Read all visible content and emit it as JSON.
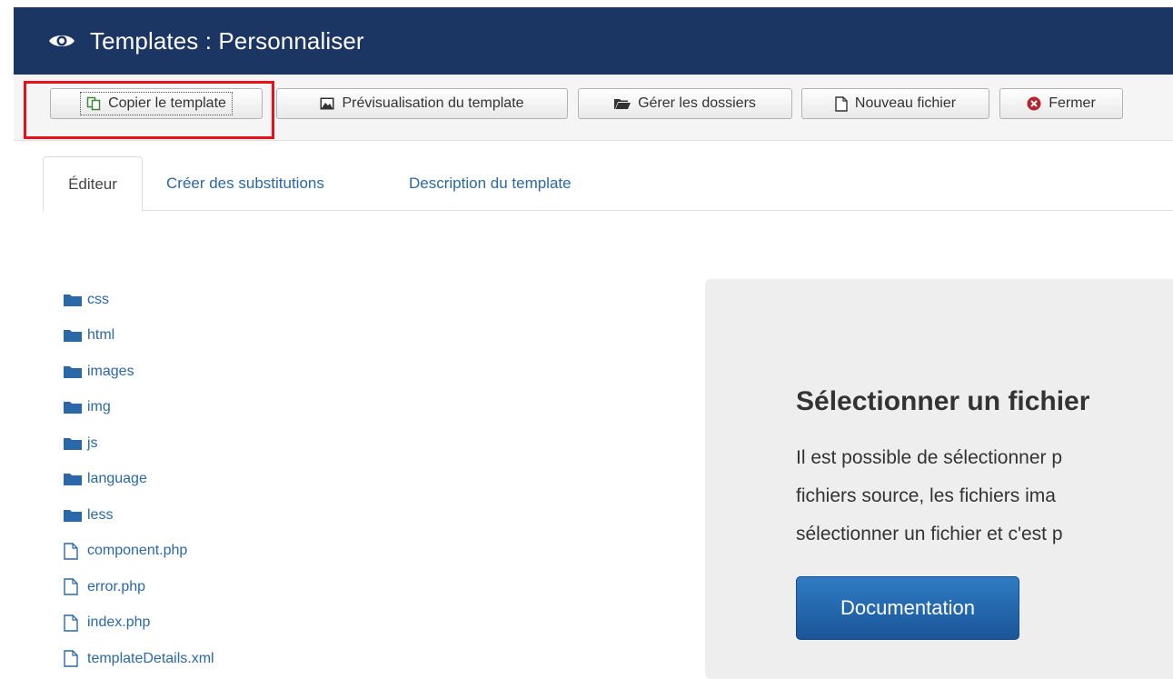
{
  "header": {
    "title": "Templates : Personnaliser",
    "icon": "eye-icon"
  },
  "toolbar": {
    "copy_label": "Copier le template",
    "preview_label": "Prévisualisation du template",
    "folders_label": "Gérer les dossiers",
    "new_file_label": "Nouveau fichier",
    "close_label": "Fermer",
    "highlight_color": "#e8101a"
  },
  "tabs": [
    {
      "label": "Éditeur"
    },
    {
      "label": "Créer des substitutions"
    },
    {
      "label": "Description du template"
    }
  ],
  "tree": {
    "folders": [
      "css",
      "html",
      "images",
      "img",
      "js",
      "language",
      "less"
    ],
    "files": [
      "component.php",
      "error.php",
      "index.php",
      "templateDetails.xml"
    ]
  },
  "panel": {
    "title": "Sélectionner un fichier",
    "lines": [
      "Il est possible de sélectionner p",
      "fichiers source, les fichiers ima",
      "sélectionner un fichier et c'est p"
    ],
    "button_label": "Documentation"
  },
  "colors": {
    "header_bg": "#1c3663",
    "link": "#2a68a8",
    "primary_button": "#1f5fa5"
  }
}
